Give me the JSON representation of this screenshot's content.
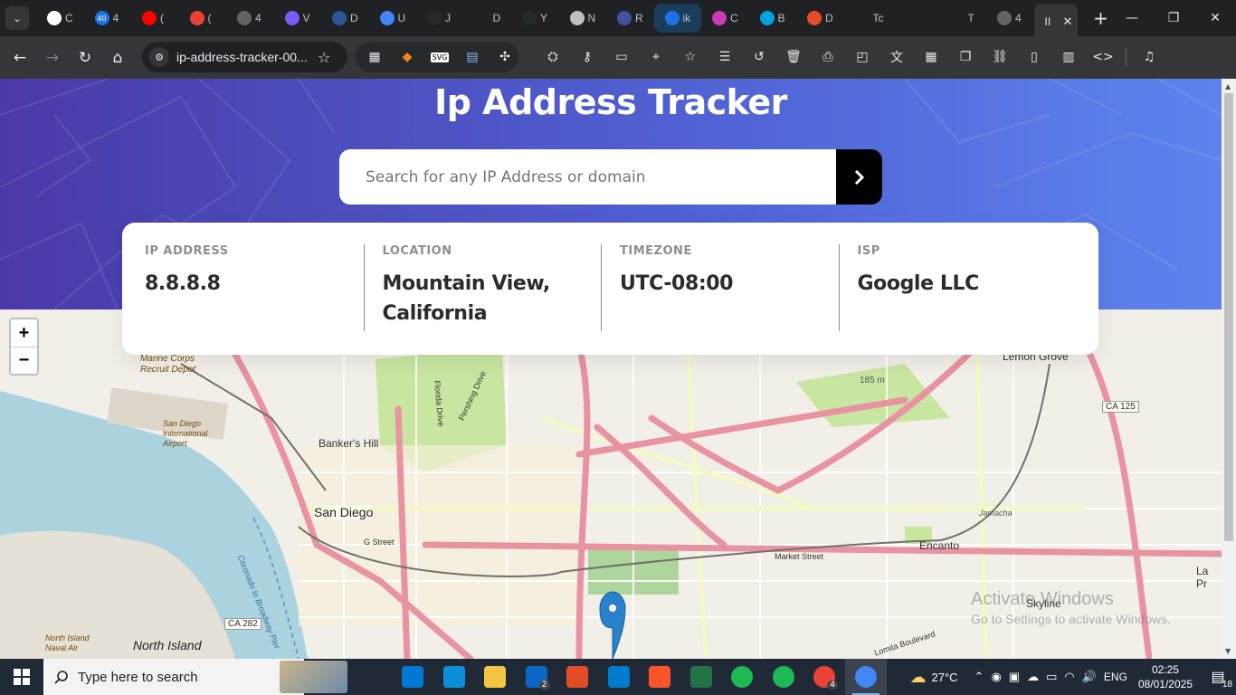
{
  "browser": {
    "tabs": [
      {
        "label": "C",
        "icon": "chatgpt-icon",
        "color": "#ffffff"
      },
      {
        "label": "4",
        "icon": "badge-40-icon",
        "color": "#1a73e8",
        "badge": "40"
      },
      {
        "label": "(",
        "icon": "youtube-icon",
        "color": "#ff0000"
      },
      {
        "label": "(",
        "icon": "gmail-icon",
        "color": "#ea4335"
      },
      {
        "label": "4",
        "icon": "globe-icon",
        "color": "#5f6368"
      },
      {
        "label": "V",
        "icon": "vite-icon",
        "color": "#7a5af8"
      },
      {
        "label": "D",
        "icon": "word-icon",
        "color": "#2b579a"
      },
      {
        "label": "U",
        "icon": "docs-icon",
        "color": "#4285f4"
      },
      {
        "label": "J",
        "icon": "github-icon",
        "color": "#24292e"
      },
      {
        "label": "D",
        "icon": "timer-icon",
        "color": "#202124"
      },
      {
        "label": "Y",
        "icon": "github-icon",
        "color": "#24292e"
      },
      {
        "label": "N",
        "icon": "chrome-icon",
        "color": "#bdc1c6"
      },
      {
        "label": "R",
        "icon": "frontend-mentor-icon",
        "color": "#3e54a3"
      },
      {
        "label": "ik",
        "icon": "github-icon",
        "color": "#1f6feb"
      },
      {
        "label": "C",
        "icon": "pocket-icon",
        "color": "#cc3bb6"
      },
      {
        "label": "B",
        "icon": "cube-icon",
        "color": "#00a3e0"
      },
      {
        "label": "D",
        "icon": "xd-icon",
        "color": "#e44d26"
      },
      {
        "label": "Tc",
        "icon": "text-icon",
        "color": "#202124"
      },
      {
        "label": "",
        "icon": "speaker-icon",
        "color": "#202124"
      },
      {
        "label": "T",
        "icon": "cloud-icon",
        "color": "#202124"
      },
      {
        "label": "4",
        "icon": "globe-icon",
        "color": "#5f6368"
      }
    ],
    "active_tab_label": "II",
    "url": "ip-address-tracker-00...",
    "window_controls": {
      "minimize": "—",
      "maximize": "❐",
      "close": "✕"
    }
  },
  "page": {
    "title": "Ip Address Tracker",
    "search": {
      "placeholder": "Search for any IP Address or domain",
      "value": ""
    },
    "info": [
      {
        "label": "IP ADDRESS",
        "value": "8.8.8.8"
      },
      {
        "label": "LOCATION",
        "value": "Mountain View, California"
      },
      {
        "label": "TIMEZONE",
        "value": "UTC-08:00"
      },
      {
        "label": "ISP",
        "value": "Google LLC"
      }
    ],
    "zoom": {
      "in": "+",
      "out": "−"
    },
    "colors": {
      "hero_start": "#4a3aa8",
      "hero_end": "#5d84ee",
      "button": "#000000"
    }
  },
  "map": {
    "labels": [
      {
        "text": "Lemon Grove"
      },
      {
        "text": "CA 125"
      },
      {
        "text": "Marine Corps Recruit Depot"
      },
      {
        "text": "San Diego International Airport"
      },
      {
        "text": "Banker's Hill"
      },
      {
        "text": "San Diego"
      },
      {
        "text": "G Street"
      },
      {
        "text": "Market Street"
      },
      {
        "text": "Encanto"
      },
      {
        "text": "Jamacha"
      },
      {
        "text": "Skyline"
      },
      {
        "text": "La Pr"
      },
      {
        "text": "North Island Naval Air"
      },
      {
        "text": "North Island"
      },
      {
        "text": "CA 282"
      },
      {
        "text": "185 m"
      },
      {
        "text": "Coronado to Broadway Pier"
      },
      {
        "text": "Pershing Drive"
      },
      {
        "text": "Florida Drive"
      },
      {
        "text": "Lomita Boulevard"
      }
    ],
    "marker": "location-marker"
  },
  "watermark": {
    "line1": "Activate Windows",
    "line2": "Go to Settings to activate Windows."
  },
  "taskbar": {
    "search_placeholder": "Type here to search",
    "apps": [
      {
        "name": "task-view",
        "color": "#1f2a36"
      },
      {
        "name": "microsoft-store",
        "color": "#0078d4"
      },
      {
        "name": "edge",
        "color": "#0c8ed9"
      },
      {
        "name": "file-explorer",
        "color": "#f5c542"
      },
      {
        "name": "linkedin",
        "color": "#0a66c2",
        "badge": "2"
      },
      {
        "name": "git",
        "color": "#e34c26"
      },
      {
        "name": "vscode",
        "color": "#007acc"
      },
      {
        "name": "brave",
        "color": "#fb542b"
      },
      {
        "name": "spreadsheet",
        "color": "#217346"
      },
      {
        "name": "spotify",
        "color": "#1db954"
      },
      {
        "name": "spotify",
        "color": "#1db954"
      },
      {
        "name": "chrome",
        "color": "#ea4335",
        "badge": "4"
      },
      {
        "name": "chrome",
        "color": "#4285f4"
      }
    ],
    "weather": "27°C",
    "language": "ENG",
    "time": "02:25",
    "date": "08/01/2025",
    "notifications": "18"
  }
}
